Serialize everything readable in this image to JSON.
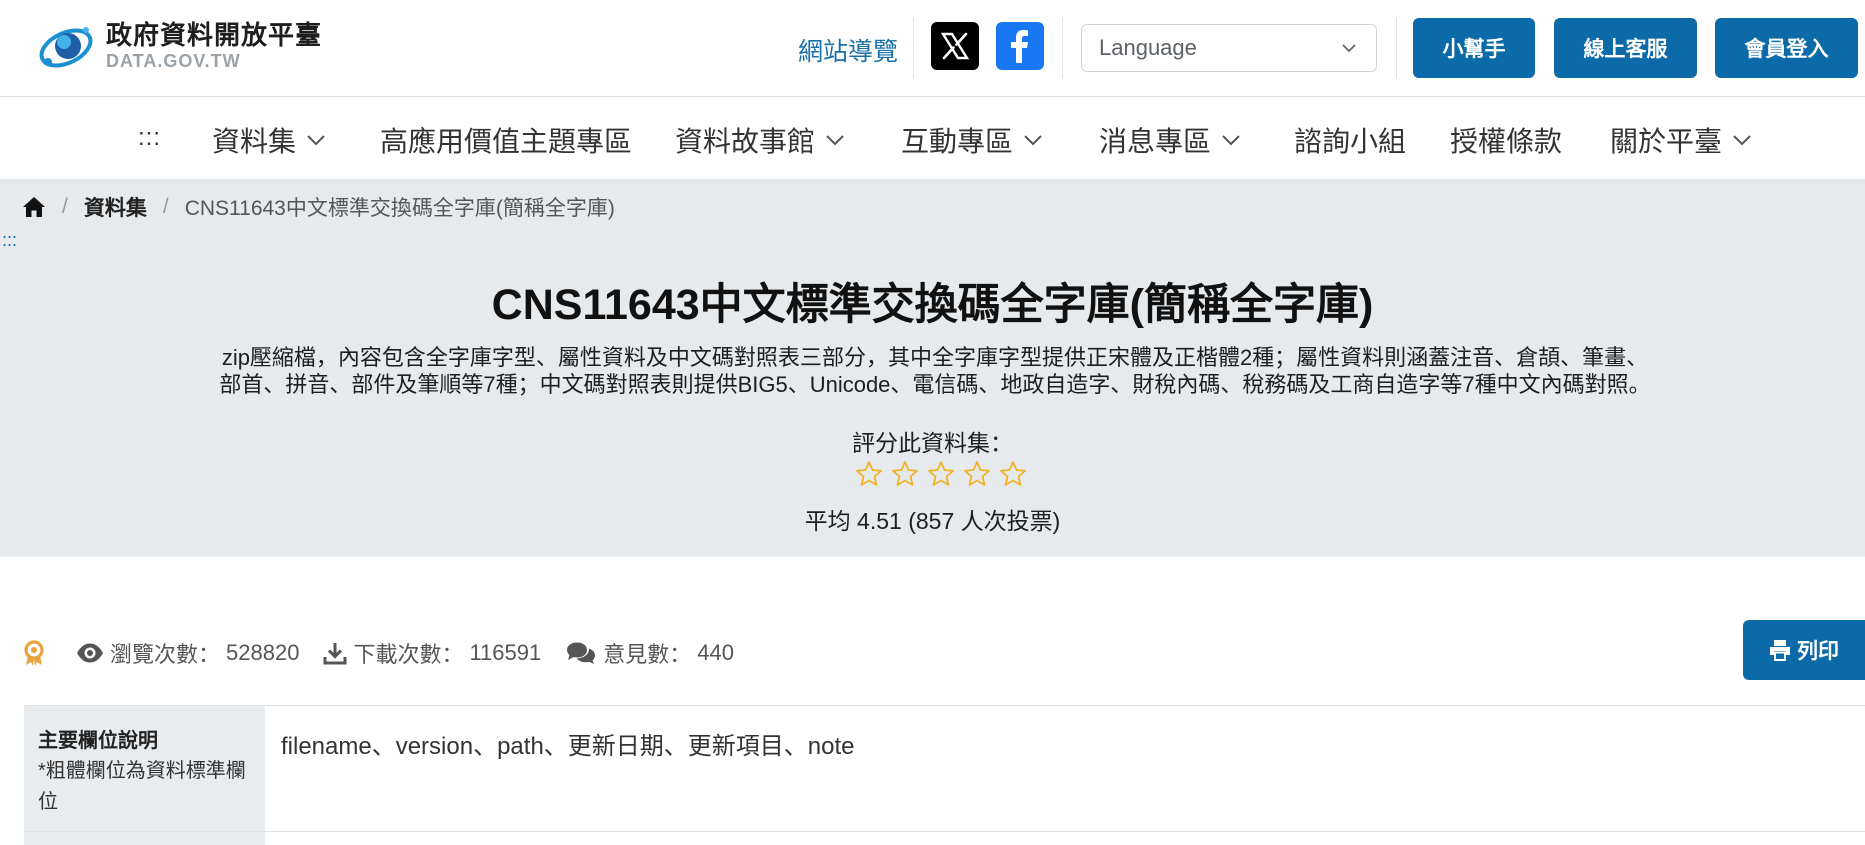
{
  "header": {
    "logo_title": "政府資料開放平臺",
    "logo_subtitle": "DATA.GOV.TW",
    "sitemap_label": "網站導覽",
    "social": [
      "x-icon",
      "facebook-icon"
    ],
    "language_placeholder": "Language",
    "helper_label": "小幫手",
    "service_label": "線上客服",
    "login_label": "會員登入"
  },
  "nav": {
    "accesskey": ":::",
    "items": [
      {
        "label": "資料集",
        "dropdown": true
      },
      {
        "label": "高應用價值主題專區",
        "dropdown": false
      },
      {
        "label": "資料故事館",
        "dropdown": true
      },
      {
        "label": "互動專區",
        "dropdown": true
      },
      {
        "label": "消息專區",
        "dropdown": true
      },
      {
        "label": "諮詢小組",
        "dropdown": false
      },
      {
        "label": "授權條款",
        "dropdown": false
      },
      {
        "label": "關於平臺",
        "dropdown": true
      }
    ]
  },
  "breadcrumb": {
    "home_icon": "home-icon",
    "items": [
      "資料集",
      "CNS11643中文標準交換碼全字庫(簡稱全字庫)"
    ]
  },
  "hero": {
    "accesskey": ":::",
    "title": "CNS11643中文標準交換碼全字庫(簡稱全字庫)",
    "desc_line1": "zip壓縮檔，內容包含全字庫字型、屬性資料及中文碼對照表三部分，其中全字庫字型提供正宋體及正楷體2種；屬性資料則涵蓋注音、倉頡、筆畫、",
    "desc_line2": "部首、拼音、部件及筆順等7種；中文碼對照表則提供BIG5、Unicode、電信碼、地政自造字、財稅內碼、稅務碼及工商自造字等7種中文內碼對照。",
    "rate_label": "評分此資料集：",
    "stars_total": 5,
    "stars_filled": 0,
    "rating_text": "平均 4.51 (857 人次投票)"
  },
  "stats": {
    "views_label": "瀏覽次數：",
    "views_value": "528820",
    "downloads_label": "下載次數：",
    "downloads_value": "116591",
    "comments_label": "意見數：",
    "comments_value": "440",
    "print_label": "列印"
  },
  "table": {
    "rows": [
      {
        "head_title": "主要欄位說明",
        "head_note": "*粗體欄位為資料標準欄位",
        "value": "filename、version、path、更新日期、更新項目、note"
      }
    ]
  },
  "colors": {
    "primary": "#0c6aa8",
    "hero_bg": "#e6eaed",
    "star": "#f0b429",
    "badge": "#e8a33d"
  }
}
